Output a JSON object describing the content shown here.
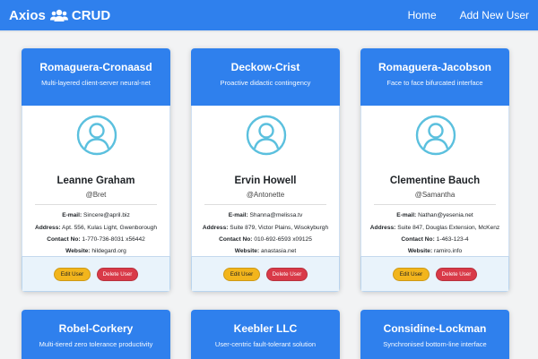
{
  "nav": {
    "brand_prefix": "Axios",
    "brand_suffix": "CRUD",
    "links": [
      "Home",
      "Add New User"
    ]
  },
  "buttons": {
    "edit_label": "Edit User",
    "delete_label": "Delete User"
  },
  "labels": {
    "email": "E-mail:",
    "address": "Address:",
    "contact": "Contact No:",
    "website": "Website:"
  },
  "users": [
    {
      "company": "Romaguera-Cronaasd",
      "catch_phrase": "Multi-layered client-server neural-net",
      "name": "Leanne Graham",
      "username": "@Bret",
      "email": "Sincere@april.biz",
      "address": "Apt. 556, Kulas Light, Gwenborough",
      "phone": "1-770-736-8031 x56442",
      "website": "hildegard.org"
    },
    {
      "company": "Deckow-Crist",
      "catch_phrase": "Proactive didactic contingency",
      "name": "Ervin Howell",
      "username": "@Antonette",
      "email": "Shanna@melissa.tv",
      "address": "Suite 879, Victor Plains, Wisokyburgh",
      "phone": "010-692-6593 x09125",
      "website": "anastasia.net"
    },
    {
      "company": "Romaguera-Jacobson",
      "catch_phrase": "Face to face bifurcated interface",
      "name": "Clementine Bauch",
      "username": "@Samantha",
      "email": "Nathan@yesenia.net",
      "address": "Suite 847, Douglas Extension, McKenz",
      "phone": "1-463-123-4",
      "website": "ramiro.info"
    },
    {
      "company": "Robel-Corkery",
      "catch_phrase": "Multi-tiered zero tolerance productivity"
    },
    {
      "company": "Keebler LLC",
      "catch_phrase": "User-centric fault-tolerant solution"
    },
    {
      "company": "Considine-Lockman",
      "catch_phrase": "Synchronised bottom-line interface"
    }
  ],
  "colors": {
    "primary": "#2f80ed",
    "warning": "#f2b51c",
    "danger": "#d93a48",
    "avatar": "#5bc0de"
  },
  "icons": {
    "brand": "users-icon",
    "avatar": "user-circle-icon"
  }
}
